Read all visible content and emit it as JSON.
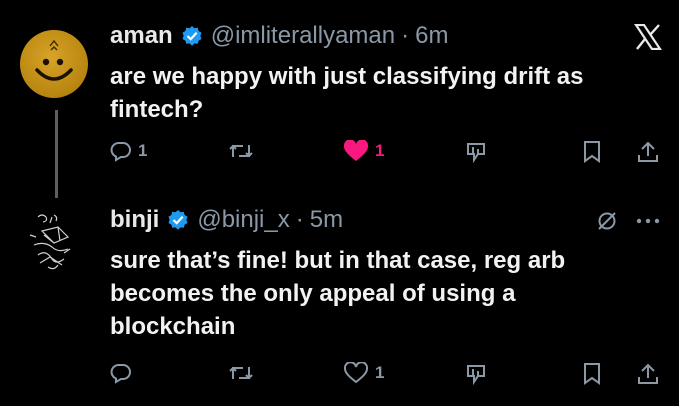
{
  "tweets": [
    {
      "name": "aman",
      "handle": "@imliterallyaman",
      "separator": "·",
      "time": "6m",
      "text_line1": "are we happy with just classifying drift as",
      "text_line2": "fintech?",
      "reply_count": "1",
      "retweet_count": "",
      "like_count": "1",
      "liked": true,
      "avatar_icon": "smiley-face-avatar"
    },
    {
      "name": "binji",
      "handle": "@binji_x",
      "separator": "·",
      "time": "5m",
      "text_line1": "sure that’s fine! but in that case, reg arb",
      "text_line2": "becomes the only appeal of using a",
      "text_line3": "blockchain",
      "reply_count": "",
      "retweet_count": "",
      "like_count": "1",
      "liked": false,
      "avatar_icon": "sketch-avatar"
    }
  ],
  "colors": {
    "background": "#000000",
    "text": "#e7e9ea",
    "muted": "#8b98a5",
    "verified": "#1d9bf0",
    "like_active": "#f91880"
  },
  "icons": [
    "x-logo-icon",
    "verified-badge-icon",
    "reply-icon",
    "retweet-icon",
    "like-icon",
    "views-icon",
    "bookmark-icon",
    "share-icon",
    "grok-icon",
    "more-icon"
  ]
}
